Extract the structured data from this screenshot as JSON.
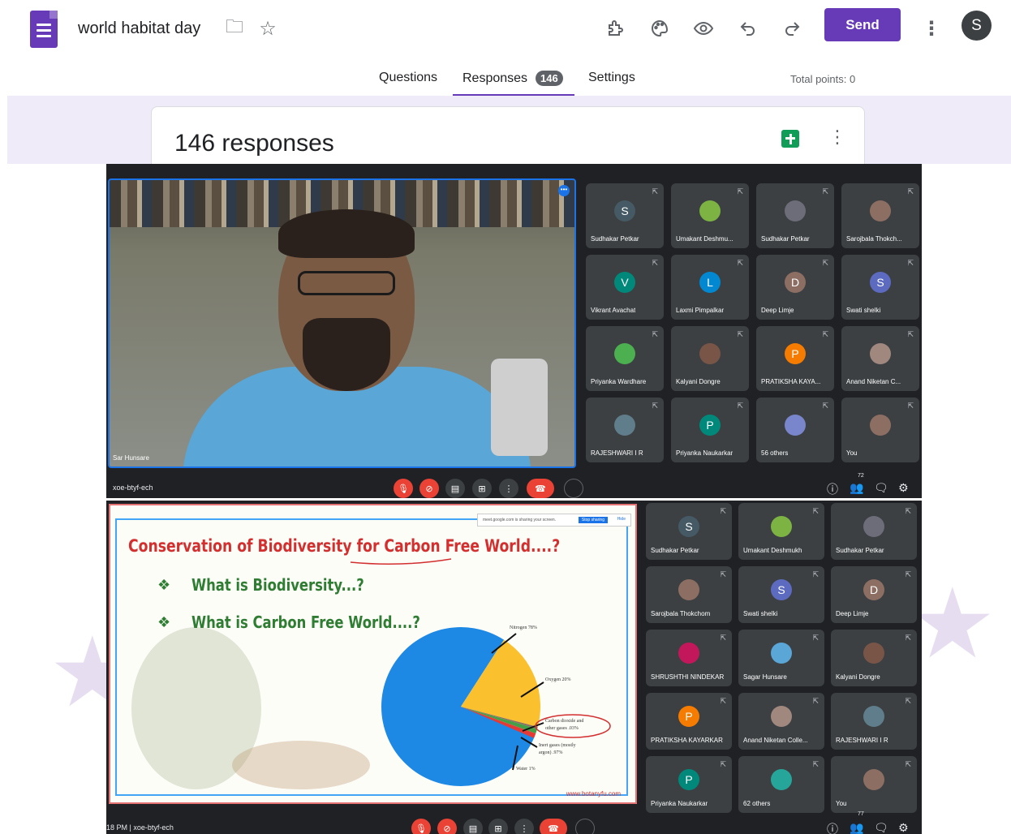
{
  "app": {
    "doc_title": "world habitat day",
    "send_label": "Send",
    "account_initial": "S"
  },
  "tabs": {
    "questions": "Questions",
    "responses": "Responses",
    "responses_count": "146",
    "settings": "Settings",
    "total_points": "Total points: 0"
  },
  "responses_card": {
    "title": "146 responses"
  },
  "meet1": {
    "speaker_name": "Sar Hunsare",
    "meeting_code": "xoe-btyf-ech",
    "people_count": "72",
    "tiles": [
      {
        "name": "Sudhakar Petkar",
        "initial": "S",
        "color": "#455a64"
      },
      {
        "name": "Umakant Deshmu...",
        "initial": "",
        "color": "#7cb342"
      },
      {
        "name": "Sudhakar Petkar",
        "initial": "",
        "color": "#6d6d7a"
      },
      {
        "name": "Sarojbala Thokch...",
        "initial": "",
        "color": "#8d6e63"
      },
      {
        "name": "Vikrant Avachat",
        "initial": "V",
        "color": "#00897b"
      },
      {
        "name": "Laxmi Pimpalkar",
        "initial": "L",
        "color": "#0288d1"
      },
      {
        "name": "Deep Limje",
        "initial": "D",
        "color": "#8d6e63"
      },
      {
        "name": "Swati shelki",
        "initial": "S",
        "color": "#5c6bc0"
      },
      {
        "name": "Priyanka Wardhare",
        "initial": "",
        "color": "#4caf50"
      },
      {
        "name": "Kalyani Dongre",
        "initial": "",
        "color": "#795548"
      },
      {
        "name": "PRATIKSHA KAYA...",
        "initial": "P",
        "color": "#f57c00"
      },
      {
        "name": "Anand Niketan C...",
        "initial": "",
        "color": "#a1887f"
      },
      {
        "name": "RAJESHWARI I R",
        "initial": "",
        "color": "#607d8b"
      },
      {
        "name": "Priyanka Naukarkar",
        "initial": "P",
        "color": "#00897b"
      },
      {
        "name": "56 others",
        "initial": "",
        "color": "#7986cb"
      },
      {
        "name": "You",
        "initial": "",
        "color": "#8d6e63"
      }
    ]
  },
  "meet2": {
    "time_and_code": "18 PM  |  xoe-btyf-ech",
    "people_count": "77",
    "tiles": [
      {
        "name": "Sudhakar Petkar",
        "initial": "S",
        "color": "#455a64"
      },
      {
        "name": "Umakant Deshmukh",
        "initial": "",
        "color": "#7cb342"
      },
      {
        "name": "Sudhakar Petkar",
        "initial": "",
        "color": "#6d6d7a"
      },
      {
        "name": "Sarojbala Thokchom",
        "initial": "",
        "color": "#8d6e63"
      },
      {
        "name": "Swati shelki",
        "initial": "S",
        "color": "#5c6bc0"
      },
      {
        "name": "Deep Limje",
        "initial": "D",
        "color": "#8d6e63"
      },
      {
        "name": "SHRUSHTHI NINDEKAR",
        "initial": "",
        "color": "#c2185b"
      },
      {
        "name": "Sagar Hunsare",
        "initial": "",
        "color": "#5aa6d6"
      },
      {
        "name": "Kalyani Dongre",
        "initial": "",
        "color": "#795548"
      },
      {
        "name": "PRATIKSHA KAYARKAR",
        "initial": "P",
        "color": "#f57c00"
      },
      {
        "name": "Anand Niketan Colle...",
        "initial": "",
        "color": "#a1887f"
      },
      {
        "name": "RAJESHWARI I R",
        "initial": "",
        "color": "#607d8b"
      },
      {
        "name": "Priyanka Naukarkar",
        "initial": "P",
        "color": "#00897b"
      },
      {
        "name": "62 others",
        "initial": "",
        "color": "#26a69a"
      },
      {
        "name": "You",
        "initial": "",
        "color": "#8d6e63"
      }
    ]
  },
  "slide": {
    "sharing_notice": "meet.google.com is sharing your screen.",
    "stop_sharing": "Stop sharing",
    "hide": "Hide",
    "title": "Conservation of Biodiversity for Carbon Free World....?",
    "bullet1": "What is Biodiversity...?",
    "bullet2": "What is Carbon Free World....?",
    "url": "www.botanyfu.com",
    "pie_labels": {
      "nitrogen": "Nitrogen 78%",
      "oxygen": "Oxygen 20%",
      "co2_1": "Carbon dioxide and",
      "co2_2": "other gases .03%",
      "inert_1": "Inert gases (mostly",
      "inert_2": "argon) .97%",
      "water": "Water 1%"
    }
  },
  "chart_data": {
    "type": "pie",
    "categories": [
      "Nitrogen",
      "Oxygen",
      "Carbon dioxide and other gases",
      "Inert gases (mostly argon)",
      "Water"
    ],
    "values": [
      78,
      20,
      0.03,
      0.97,
      1
    ],
    "colors": [
      "#1e88e5",
      "#fbc02d",
      "#8d6e63",
      "#43a047",
      "#e53935"
    ]
  }
}
